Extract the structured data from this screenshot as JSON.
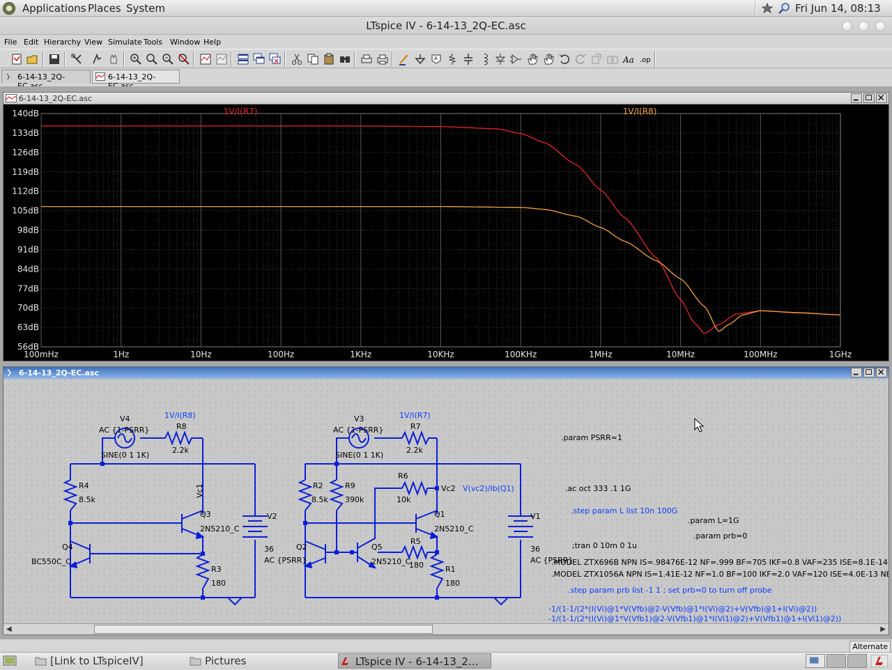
{
  "top_panel": {
    "menus": [
      "Applications",
      "Places",
      "System"
    ],
    "clock": "Fri Jun 14, 08:13"
  },
  "window": {
    "title": "LTspice IV - 6-14-13_2Q-EC.asc"
  },
  "menubar": {
    "items": [
      {
        "label": "File"
      },
      {
        "label": "Edit"
      },
      {
        "label": "Hierarchy"
      },
      {
        "label": "View"
      },
      {
        "label": "Simulate"
      },
      {
        "label": "Tools"
      },
      {
        "label": "Window"
      },
      {
        "label": "Help"
      }
    ]
  },
  "toolbar": {
    "icons": [
      "schematic-icon",
      "open-icon",
      "save-icon",
      "control-panel-icon",
      "run-icon",
      "halt-icon",
      "zoom-in-icon",
      "zoom-pan-icon",
      "zoom-out-icon",
      "zoom-cancel-icon",
      "autorange-icon",
      "plot-settings-icon",
      "tile-icon",
      "cascade-icon",
      "close-window-icon",
      "cut-icon",
      "copy-icon",
      "paste-icon",
      "find-icon",
      "print-setup-icon",
      "print-icon",
      "wire-icon",
      "ground-icon",
      "label-icon",
      "resistor-icon",
      "capacitor-icon",
      "inductor-icon",
      "diode-icon",
      "component-icon",
      "move-icon",
      "drag-icon",
      "undo-icon",
      "redo-icon",
      "rotate-icon",
      "mirror-icon",
      "text-icon",
      "spice-directive-icon"
    ]
  },
  "tabs": [
    {
      "label": "6-14-13_2Q-EC.asc",
      "kind": "schematic"
    },
    {
      "label": "6-14-13_2Q-EC.asc",
      "kind": "waveform"
    }
  ],
  "plot_window": {
    "title": "6-14-13_2Q-EC.asc",
    "traces": [
      {
        "label": "1V/I(R7)",
        "color": "#e8232b"
      },
      {
        "label": "1V/I(R8)",
        "color": "#f5a142"
      }
    ],
    "y_ticks": [
      "140dB",
      "133dB",
      "126dB",
      "119dB",
      "112dB",
      "105dB",
      "98dB",
      "91dB",
      "84dB",
      "77dB",
      "70dB",
      "63dB",
      "56dB"
    ],
    "x_ticks": [
      "100mHz",
      "1Hz",
      "10Hz",
      "100Hz",
      "1KHz",
      "10KHz",
      "100KHz",
      "1MHz",
      "10MHz",
      "100MHz",
      "1GHz"
    ]
  },
  "chart_data": {
    "type": "line",
    "x_scale": "log",
    "xlim": [
      "100mHz",
      "1GHz"
    ],
    "ylim": [
      56,
      140
    ],
    "ylabel_unit": "dB",
    "grid": true,
    "series": [
      {
        "name": "1V/I(R7)",
        "color": "#e8232b",
        "x_hz": [
          0.1,
          1000,
          10000,
          50000,
          100000,
          200000,
          500000,
          1000000,
          2000000,
          5000000,
          10000000,
          15000000,
          20000000,
          30000000,
          50000000,
          100000000,
          300000000,
          1000000000
        ],
        "y_db": [
          135.5,
          135.5,
          135.3,
          134.5,
          132.8,
          129.5,
          121.5,
          112.5,
          102.5,
          88,
          73,
          64.5,
          60.8,
          64,
          67.8,
          69,
          68.2,
          67.5
        ]
      },
      {
        "name": "1V/I(R8)",
        "color": "#f5a142",
        "x_hz": [
          0.1,
          10000,
          100000,
          200000,
          500000,
          1000000,
          2000000,
          5000000,
          10000000,
          20000000,
          30000000,
          40000000,
          60000000,
          100000000,
          300000000,
          1000000000
        ],
        "y_db": [
          106.5,
          106.5,
          106.2,
          105.5,
          103,
          99,
          94,
          87,
          80.5,
          70.5,
          61.5,
          64,
          67.5,
          69,
          68.3,
          67.5
        ]
      }
    ]
  },
  "schematic_window": {
    "title": "6-14-13_2Q-EC.asc",
    "labels": {
      "v4": "V4",
      "v4_ac": "AC {1-PSRR}",
      "v4_sine": "SINE(0 1 1K)",
      "r8_probe": "1V/I(R8)",
      "r8": "R8",
      "r8_val": "2.2k",
      "r4": "R4",
      "r4_val": "8.5k",
      "vc1": "Vc1",
      "q3": "Q3",
      "q3_model": "2N5210_C",
      "v2": "V2",
      "v2_val": "36",
      "v2_ac": "AC {PSRR}",
      "q4": "Q4",
      "q4_model": "BC550C_C",
      "r3": "R3",
      "r3_val": "180",
      "v3": "V3",
      "v3_ac": "AC {1-PSRR}",
      "v3_sine": "SINE(0 1 1K)",
      "r7_probe": "1V/I(R7)",
      "r7": "R7",
      "r7_val": "2.2k",
      "r2": "R2",
      "r2_val": "8.5k",
      "r9": "R9",
      "r9_val": "390k",
      "r6": "R6",
      "r6_val": "10k",
      "vc2": "Vc2",
      "vc2_expr": "V(vc2)/Ib(Q1)",
      "q1": "Q1",
      "q1_model": "2N5210_C",
      "v1": "V1",
      "v1_val": "36",
      "v1_ac": "AC {PSRR}",
      "q2": "Q2",
      "q5": "Q5",
      "q5_model": "2N5210_C",
      "r5": "R5",
      "r5_val": "180",
      "r1": "R1",
      "r1_val": "180"
    },
    "directives": [
      {
        "text": ".param PSRR=1",
        "color": "#000"
      },
      {
        "text": ".ac oct 333 .1 1G",
        "color": "#000"
      },
      {
        "text": ".step param L list 10n 100G",
        "color": "#0a3cff"
      },
      {
        "text": ".param L=1G",
        "color": "#000"
      },
      {
        "text": ".param prb=0",
        "color": "#000"
      },
      {
        "text": ";tran 0 10m 0 1u",
        "color": "#000"
      },
      {
        "text": ".MODEL ZTX696B NPN IS=.98476E-12 NF=.999 BF=705 IKF=0.8 VAF=235 ISE=8.1E-14 NE",
        "color": "#000"
      },
      {
        "text": ".MODEL ZTX1056A NPN IS=1.41E-12 NF=1.0 BF=100 IKF=2.0 VAF=120 ISE=4.0E-13 NE=",
        "color": "#000"
      },
      {
        "text": ".step param prb list -1 1 ; set prb=0 to turn off probe",
        "color": "#0a3cff"
      },
      {
        "text": "-1/(1-1/(2*(I(Vi)@1*V(Vfb)@2-V(Vfb)@1*I(Vi)@2)+V(Vfb)@1+I(Vi)@2))",
        "color": "#0a3cff"
      },
      {
        "text": "-1/(1-1/(2*(I(Vi)@1*V(Vfb1)@2-V(Vfb1)@1*I(Vi1)@2)+V(Vfb1)@1+I(Vi1)@2))",
        "color": "#0a3cff"
      }
    ]
  },
  "status": {
    "alt": "Alternate"
  },
  "taskbar": {
    "items": [
      {
        "label": "[Link to LTspiceIV]"
      },
      {
        "label": "Pictures"
      },
      {
        "label": "LTspice IV - 6-14-13_2..."
      }
    ]
  }
}
